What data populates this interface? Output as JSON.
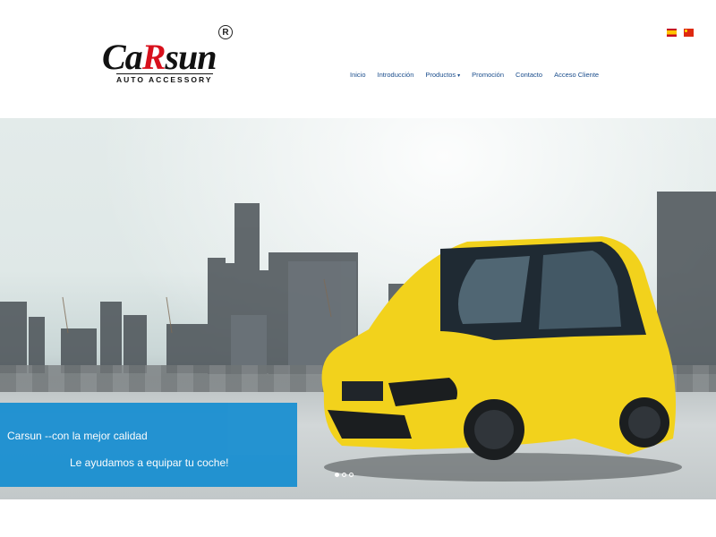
{
  "brand": {
    "logo_main_a": "Ca",
    "logo_main_r": "R",
    "logo_main_b": "sun",
    "logo_registered": "R",
    "logo_sub": "AUTO ACCESSORY"
  },
  "languages": [
    {
      "code": "es",
      "icon": "spain-flag-icon"
    },
    {
      "code": "cn",
      "icon": "china-flag-icon"
    }
  ],
  "nav": {
    "items": [
      {
        "label": "Inicio"
      },
      {
        "label": "Introducción"
      },
      {
        "label": "Productos",
        "dropdown": true
      },
      {
        "label": "Promoción"
      },
      {
        "label": "Contacto"
      },
      {
        "label": "Acceso Cliente"
      }
    ],
    "color": "#1a4d8c"
  },
  "hero": {
    "caption_line1": "Carsun --con la mejor calidad",
    "caption_line2": "Le ayudamos a equipar tu coche!",
    "caption_bg": "#1a8fd1",
    "car_color": "#f2d21c",
    "slides_total": 3,
    "slide_active": 1
  }
}
